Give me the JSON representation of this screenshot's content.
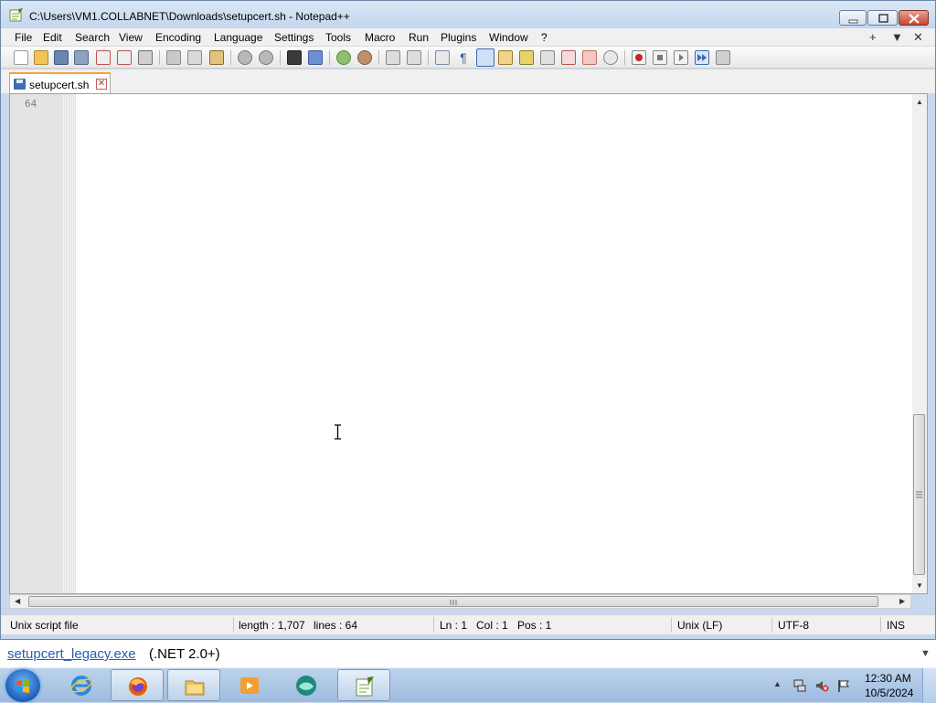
{
  "window": {
    "title": "C:\\Users\\VM1.COLLABNET\\Downloads\\setupcert.sh - Notepad++"
  },
  "menu": {
    "items": [
      "File",
      "Edit",
      "Search",
      "View",
      "Encoding",
      "Language",
      "Settings",
      "Tools",
      "Macro",
      "Run",
      "Plugins",
      "Window",
      "?"
    ],
    "right": [
      "+",
      "▼",
      "✕"
    ]
  },
  "toolbar": {
    "icons": [
      "new-file-icon",
      "open-file-icon",
      "save-icon",
      "save-all-icon",
      "close-icon",
      "close-all-icon",
      "print-icon",
      "cut-icon",
      "copy-icon",
      "paste-icon",
      "undo-icon",
      "redo-icon",
      "find-icon",
      "replace-icon",
      "zoom-in-icon",
      "zoom-out-icon",
      "sync-vertical-icon",
      "sync-horizontal-icon",
      "word-wrap-icon",
      "show-all-chars-icon",
      "indent-guide-icon",
      "user-defined-language-icon",
      "document-map-icon",
      "document-list-icon",
      "function-list-icon",
      "folder-as-workspace-icon",
      "monitoring-icon",
      "record-macro-icon",
      "stop-recording-icon",
      "playback-macro-icon",
      "run-macro-multiple-icon",
      "save-macro-icon"
    ]
  },
  "tab": {
    "label": "setupcert.sh",
    "close": "✕"
  },
  "editor": {
    "line_number": "64"
  },
  "status": {
    "file_type": "Unix script file",
    "length": "length : 1,707",
    "lines": "lines : 64",
    "ln": "Ln : 1",
    "col": "Col : 1",
    "pos": "Pos : 1",
    "eol": "Unix (LF)",
    "encoding": "UTF-8",
    "mode": "INS"
  },
  "caption": {
    "link": "setupcert_legacy.exe",
    "suffix": "(.NET 2.0+)"
  },
  "taskbar": {
    "apps": [
      "internet-explorer-icon",
      "firefox-icon",
      "file-explorer-icon",
      "media-player-icon",
      "app-icon",
      "notepad-plus-plus-icon"
    ],
    "clock_time": "12:30 AM",
    "clock_date": "10/5/2024"
  }
}
